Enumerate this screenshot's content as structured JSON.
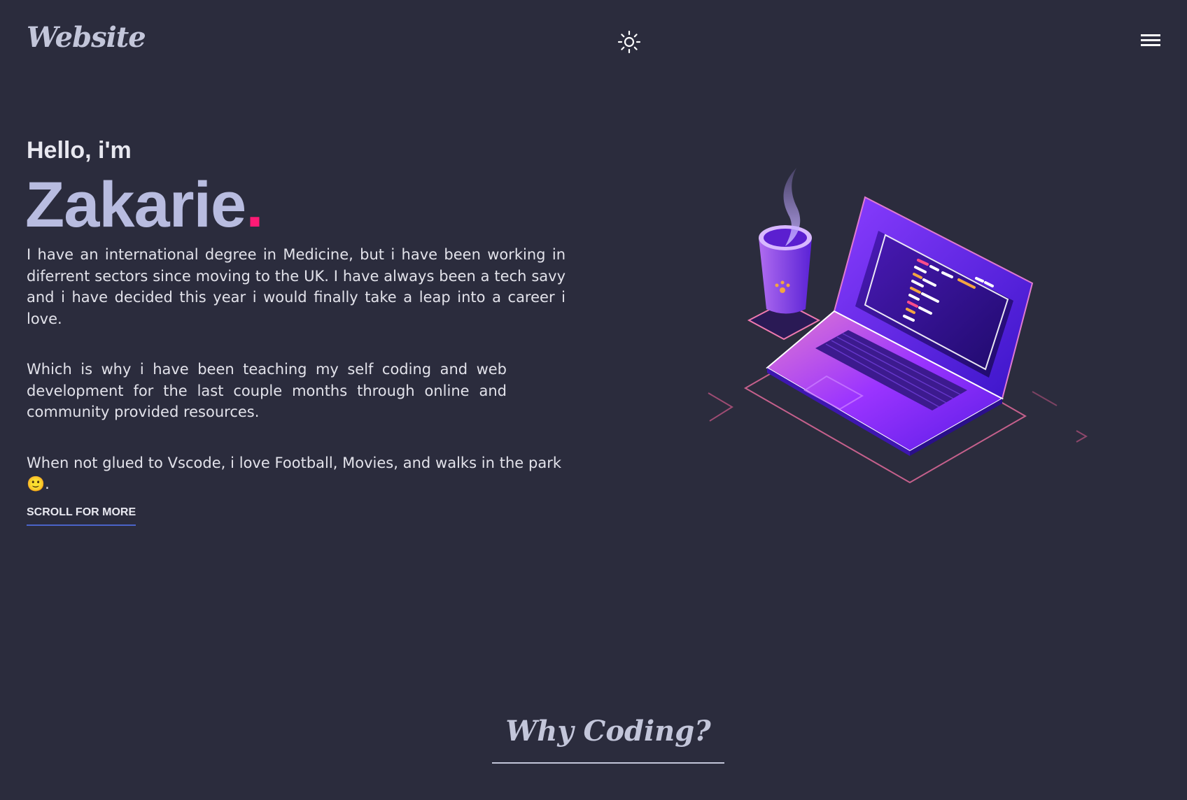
{
  "header": {
    "logo": "Website",
    "theme_toggle_icon": "sun-icon",
    "menu_icon": "hamburger-menu-icon"
  },
  "hero": {
    "greeting": "Hello, i'm",
    "name": "Zakarie",
    "name_suffix": ".",
    "paragraphs": [
      "I have an international degree in Medicine, but i have been working in diferrent sectors since moving to the UK. I have always been a tech savy and i have decided this year i would finally take a leap into a career i love.",
      "Which is why i have been teaching my self coding and web development for the last couple months through online and community provided resources.",
      "When not glued to Vscode, i love Football, Movies, and walks in the park 🙂."
    ],
    "scroll_link": "SCROLL FOR MORE"
  },
  "illustration": {
    "icon": "laptop-coffee-illustration"
  },
  "next_section": {
    "title": "Why Coding?"
  },
  "colors": {
    "background": "#2b2c3d",
    "accent_pink": "#ff1a75",
    "name_color": "#b8bce0",
    "underline_blue": "#4a63c8"
  }
}
